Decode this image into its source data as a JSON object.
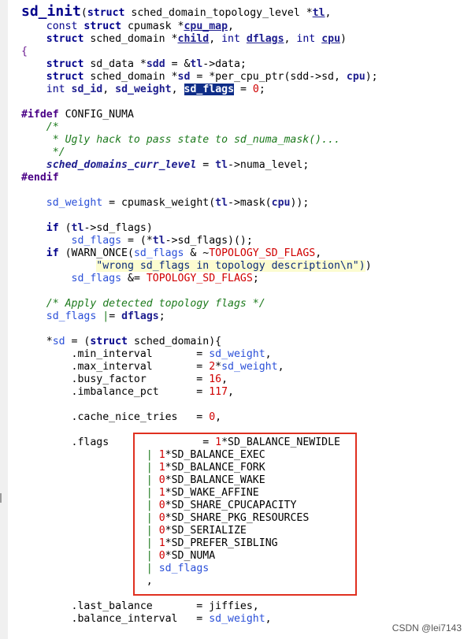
{
  "code": {
    "func_name": "sd_init",
    "params_line1": "(struct sched_domain_topology_level *tl,",
    "params_line2": "const struct cpumask *cpu_map,",
    "params_line3": "struct sched_domain *child, int dflags, int cpu)",
    "open_brace": "{",
    "decl1": "struct sd_data *sdd = &tl->data;",
    "decl2": "struct sched_domain *sd = *per_cpu_ptr(sdd->sd, cpu);",
    "decl3_prefix": "int sd_id, sd_weight, ",
    "decl3_selected": "sd_flags",
    "decl3_suffix": " = 0;",
    "ifdef": "#ifdef CONFIG_NUMA",
    "comment1": "/*",
    "comment2": " * Ugly hack to pass state to sd_numa_mask()...",
    "comment3": " */",
    "numa_assign_var": "sched_domains_curr_level",
    "numa_assign_rest": " = tl->numa_level;",
    "endif": "#endif",
    "weight_line": "sd_weight = cpumask_weight(tl->mask(cpu));",
    "if_flags": "if (tl->sd_flags)",
    "flags_call": "sd_flags = (*tl->sd_flags)();",
    "warn_line": "if (WARN_ONCE(sd_flags & ~TOPOLOGY_SD_FLAGS,",
    "warn_string": "\"wrong sd_flags in topology description\\n\")",
    "warn_close": ")",
    "mask_line": "sd_flags &= TOPOLOGY_SD_FLAGS;",
    "comment_apply": "/* Apply detected topology flags */",
    "apply_line": "sd_flags |= dflags;",
    "sd_assign": "*sd = (struct sched_domain){",
    "min_interval": ".min_interval       = sd_weight,",
    "max_interval": ".max_interval       = 2*sd_weight,",
    "busy_factor": ".busy_factor        = 16,",
    "imbalance_pct": ".imbalance_pct      = 117,",
    "cache_nice_tries": ".cache_nice_tries   = 0,",
    "flags_field": ".flags",
    "flags_first": "= 1*SD_BALANCE_NEWIDLE",
    "flag_items": [
      "1*SD_BALANCE_EXEC",
      "1*SD_BALANCE_FORK",
      "0*SD_BALANCE_WAKE",
      "1*SD_WAKE_AFFINE",
      "0*SD_SHARE_CPUCAPACITY",
      "0*SD_SHARE_PKG_RESOURCES",
      "0*SD_SERIALIZE",
      "1*SD_PREFER_SIBLING",
      "0*SD_NUMA",
      "sd_flags"
    ],
    "flags_end": ",",
    "last_balance": ".last_balance       = jiffies,",
    "balance_interval": ".balance_interval   = sd_weight,"
  },
  "watermark": "CSDN @lei7143"
}
